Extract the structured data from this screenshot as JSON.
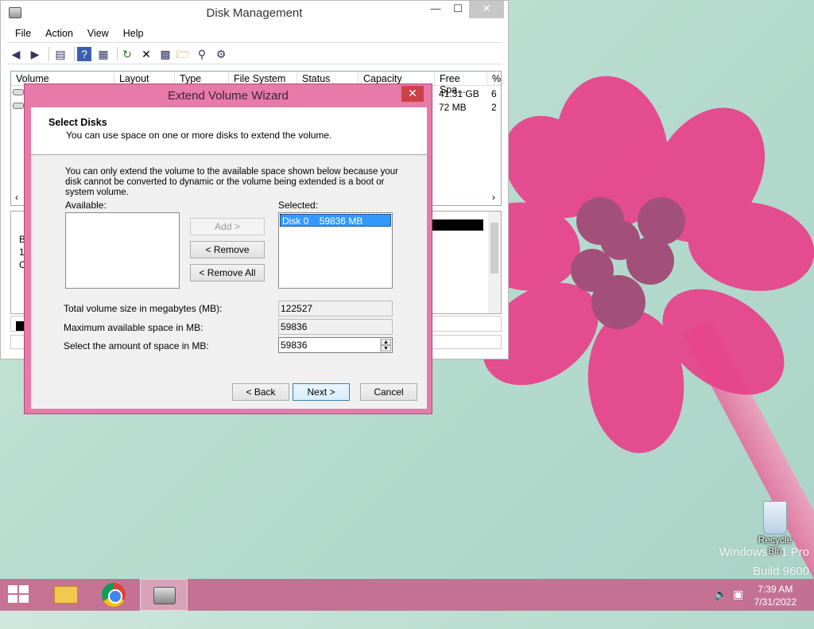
{
  "desktop": {
    "watermark_line1": "Windows 8.1 Pro",
    "watermark_line2": "Build 9600",
    "recycle_bin_label": "Recycle Bin"
  },
  "disk_management": {
    "title": "Disk Management",
    "window_controls": {
      "minimize": "—",
      "maximize": "☐",
      "close": "✕"
    },
    "menu": [
      "File",
      "Action",
      "View",
      "Help"
    ],
    "columns": [
      "Volume",
      "Layout",
      "Type",
      "File System",
      "Status",
      "Capacity",
      "Free Spa...",
      "%"
    ],
    "rows": [
      {
        "free_space": "41.31 GB",
        "percent": "6"
      },
      {
        "free_space": "72 MB",
        "percent": "2"
      }
    ],
    "graph_labels": [
      "B",
      "1",
      "C"
    ]
  },
  "wizard": {
    "title": "Extend Volume Wizard",
    "close": "✕",
    "header_title": "Select Disks",
    "header_subtitle": "You can use space on one or more disks to extend the volume.",
    "info": "You can only extend the volume to the available space shown below because your disk cannot be converted to dynamic or the volume being extended is a boot or system volume.",
    "available_label": "Available:",
    "selected_label": "Selected:",
    "selected_items": [
      {
        "disk": "Disk 0",
        "size": "59836 MB"
      }
    ],
    "buttons": {
      "add": "Add >",
      "remove": "< Remove",
      "remove_all": "< Remove All",
      "back": "< Back",
      "next": "Next >",
      "cancel": "Cancel"
    },
    "total_size_label": "Total volume size in megabytes (MB):",
    "total_size_value": "122527",
    "max_space_label": "Maximum available space in MB:",
    "max_space_value": "59836",
    "select_amount_label": "Select the amount of space in MB:",
    "select_amount_value": "59836"
  },
  "taskbar": {
    "time": "7:39 AM",
    "date": "7/31/2022"
  }
}
